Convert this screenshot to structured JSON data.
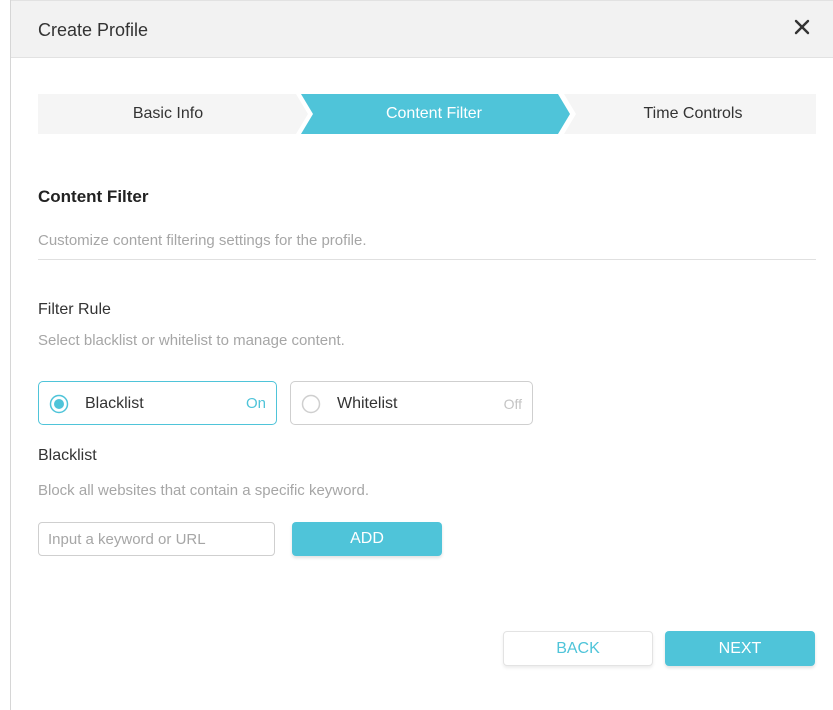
{
  "dialog": {
    "title": "Create Profile",
    "close_icon": "close-x-icon"
  },
  "steps": [
    {
      "label": "Basic Info",
      "active": false
    },
    {
      "label": "Content Filter",
      "active": true
    },
    {
      "label": "Time Controls",
      "active": false
    }
  ],
  "section": {
    "title": "Content Filter",
    "description": "Customize content filtering settings for the profile."
  },
  "filter_rule": {
    "label": "Filter Rule",
    "hint": "Select blacklist or whitelist to manage content.",
    "options": [
      {
        "name": "Blacklist",
        "state": "On",
        "selected": true
      },
      {
        "name": "Whitelist",
        "state": "Off",
        "selected": false
      }
    ]
  },
  "blacklist": {
    "label": "Blacklist",
    "hint": "Block all websites that contain a specific keyword.",
    "input_value": "",
    "input_placeholder": "Input a keyword or URL",
    "add_label": "ADD"
  },
  "footer": {
    "back_label": "BACK",
    "next_label": "NEXT"
  },
  "colors": {
    "accent": "#4fc4d9",
    "header_bg": "#f2f2f2",
    "step_bg": "#f5f5f5",
    "muted_text": "#a6a6a6"
  }
}
